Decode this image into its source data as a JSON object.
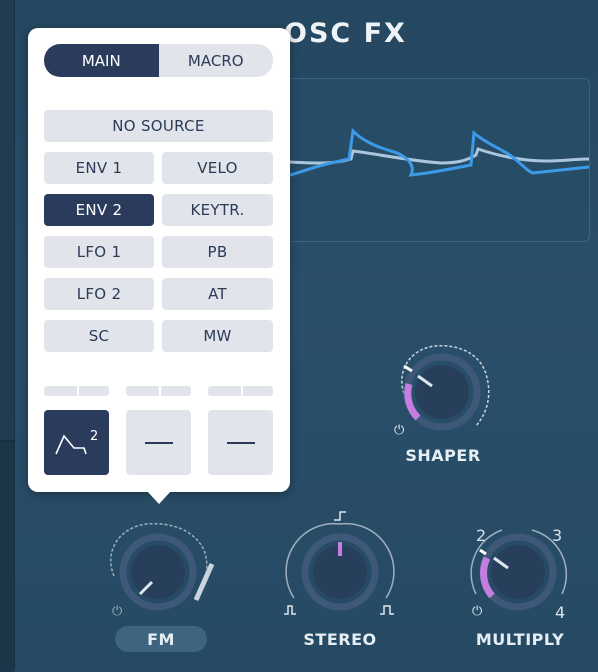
{
  "title": "OSC FX",
  "popup": {
    "tabs": [
      {
        "label": "MAIN",
        "active": true
      },
      {
        "label": "MACRO",
        "active": false
      }
    ],
    "sources": {
      "no_source": "NO SOURCE",
      "env1": "ENV 1",
      "velo": "VELO",
      "env2": "ENV 2",
      "keytr": "KEYTR.",
      "lfo1": "LFO 1",
      "pb": "PB",
      "lfo2": "LFO 2",
      "at": "AT",
      "sc": "SC",
      "mw": "MW"
    },
    "active_source": "ENV 2",
    "slots": [
      {
        "icon": "envelope-icon",
        "badge": "2",
        "active": true
      },
      {
        "icon": "empty-slot-icon",
        "active": false
      },
      {
        "icon": "empty-slot-icon",
        "active": false
      }
    ]
  },
  "knobs": {
    "shaper": {
      "label": "SHAPER"
    },
    "fm": {
      "label": "FM"
    },
    "stereo": {
      "label": "STEREO"
    },
    "multiply": {
      "label": "MULTIPLY",
      "marks": [
        "2",
        "3",
        "4"
      ]
    }
  },
  "colors": {
    "accent": "#c57ee0",
    "active": "#2b3b5c",
    "scope_primary": "#3d9ae8",
    "scope_secondary": "#a9c6dc"
  }
}
